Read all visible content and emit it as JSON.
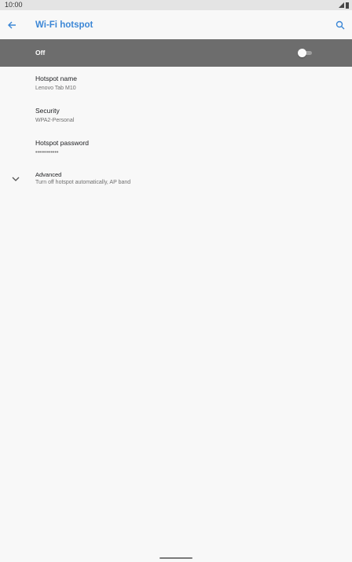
{
  "status_bar": {
    "time": "10:00"
  },
  "toolbar": {
    "title": "Wi-Fi hotspot",
    "back_icon": "arrow-back-icon",
    "search_icon": "search-icon"
  },
  "master_switch": {
    "label": "Off",
    "state": "off"
  },
  "settings": [
    {
      "title": "Hotspot name",
      "summary": "Lenovo Tab M10"
    },
    {
      "title": "Security",
      "summary": "WPA2-Personal"
    },
    {
      "title": "Hotspot password",
      "summary": "••••••••••••"
    }
  ],
  "advanced": {
    "title": "Advanced",
    "summary": "Turn off hotspot automatically, AP band",
    "icon": "chevron-down-icon"
  },
  "colors": {
    "accent": "#3c87d6",
    "switch_bar": "#6d6d6d",
    "background": "#f8f8f8",
    "status_bar": "#e4e4e4"
  }
}
